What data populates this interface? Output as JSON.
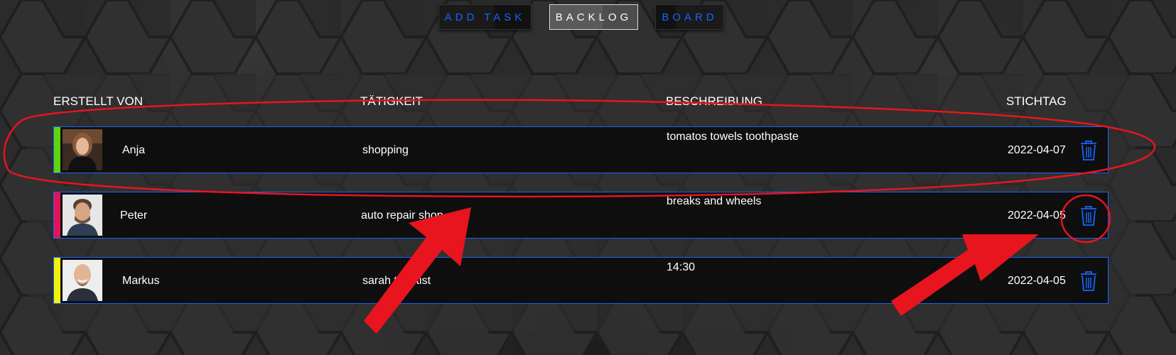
{
  "nav": {
    "add_task": "ADD TASK",
    "backlog": "BACKLOG",
    "board": "BOARD"
  },
  "columns": {
    "created_by": "ERSTELLT VON",
    "activity": "TÄTIGKEIT",
    "description": "BESCHREIBUNG",
    "due": "STICHTAG"
  },
  "tasks": [
    {
      "name": "Anja",
      "activity": "shopping",
      "description": "tomatos towels toothpaste",
      "due": "2022-04-07",
      "stripe_color": "#5fd40f"
    },
    {
      "name": "Peter",
      "activity": "auto repair shop",
      "description": "breaks and wheels",
      "due": "2022-04-05",
      "stripe_color": "#e0145a"
    },
    {
      "name": "Markus",
      "activity": "sarah tdentist",
      "description": "14:30",
      "due": "2022-04-05",
      "stripe_color": "#f2f20a"
    }
  ],
  "colors": {
    "accent": "#1565ff",
    "annotation": "#e8141e"
  }
}
